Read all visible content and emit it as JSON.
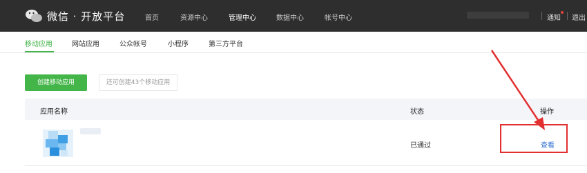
{
  "header": {
    "brand": "微信 · 开放平台",
    "nav": [
      "首页",
      "资源中心",
      "管理中心",
      "数据中心",
      "帐号中心"
    ],
    "active_nav": "管理中心",
    "notice_label": "通知",
    "logout_label": "退出"
  },
  "subnav": {
    "tabs": [
      "移动应用",
      "网站应用",
      "公众帐号",
      "小程序",
      "第三方平台"
    ],
    "active_tab": "移动应用"
  },
  "actions": {
    "create_label": "创建移动应用",
    "quota_label": "还可创建43个移动应用"
  },
  "table": {
    "columns": [
      "应用名称",
      "状态",
      "操作"
    ],
    "rows": [
      {
        "status": "已通过",
        "action": "查看"
      }
    ]
  },
  "colors": {
    "topbar": "#2e2e2e",
    "accent_green": "#44b549",
    "link_blue": "#2e6fd1",
    "annotation_red": "#e23030"
  }
}
